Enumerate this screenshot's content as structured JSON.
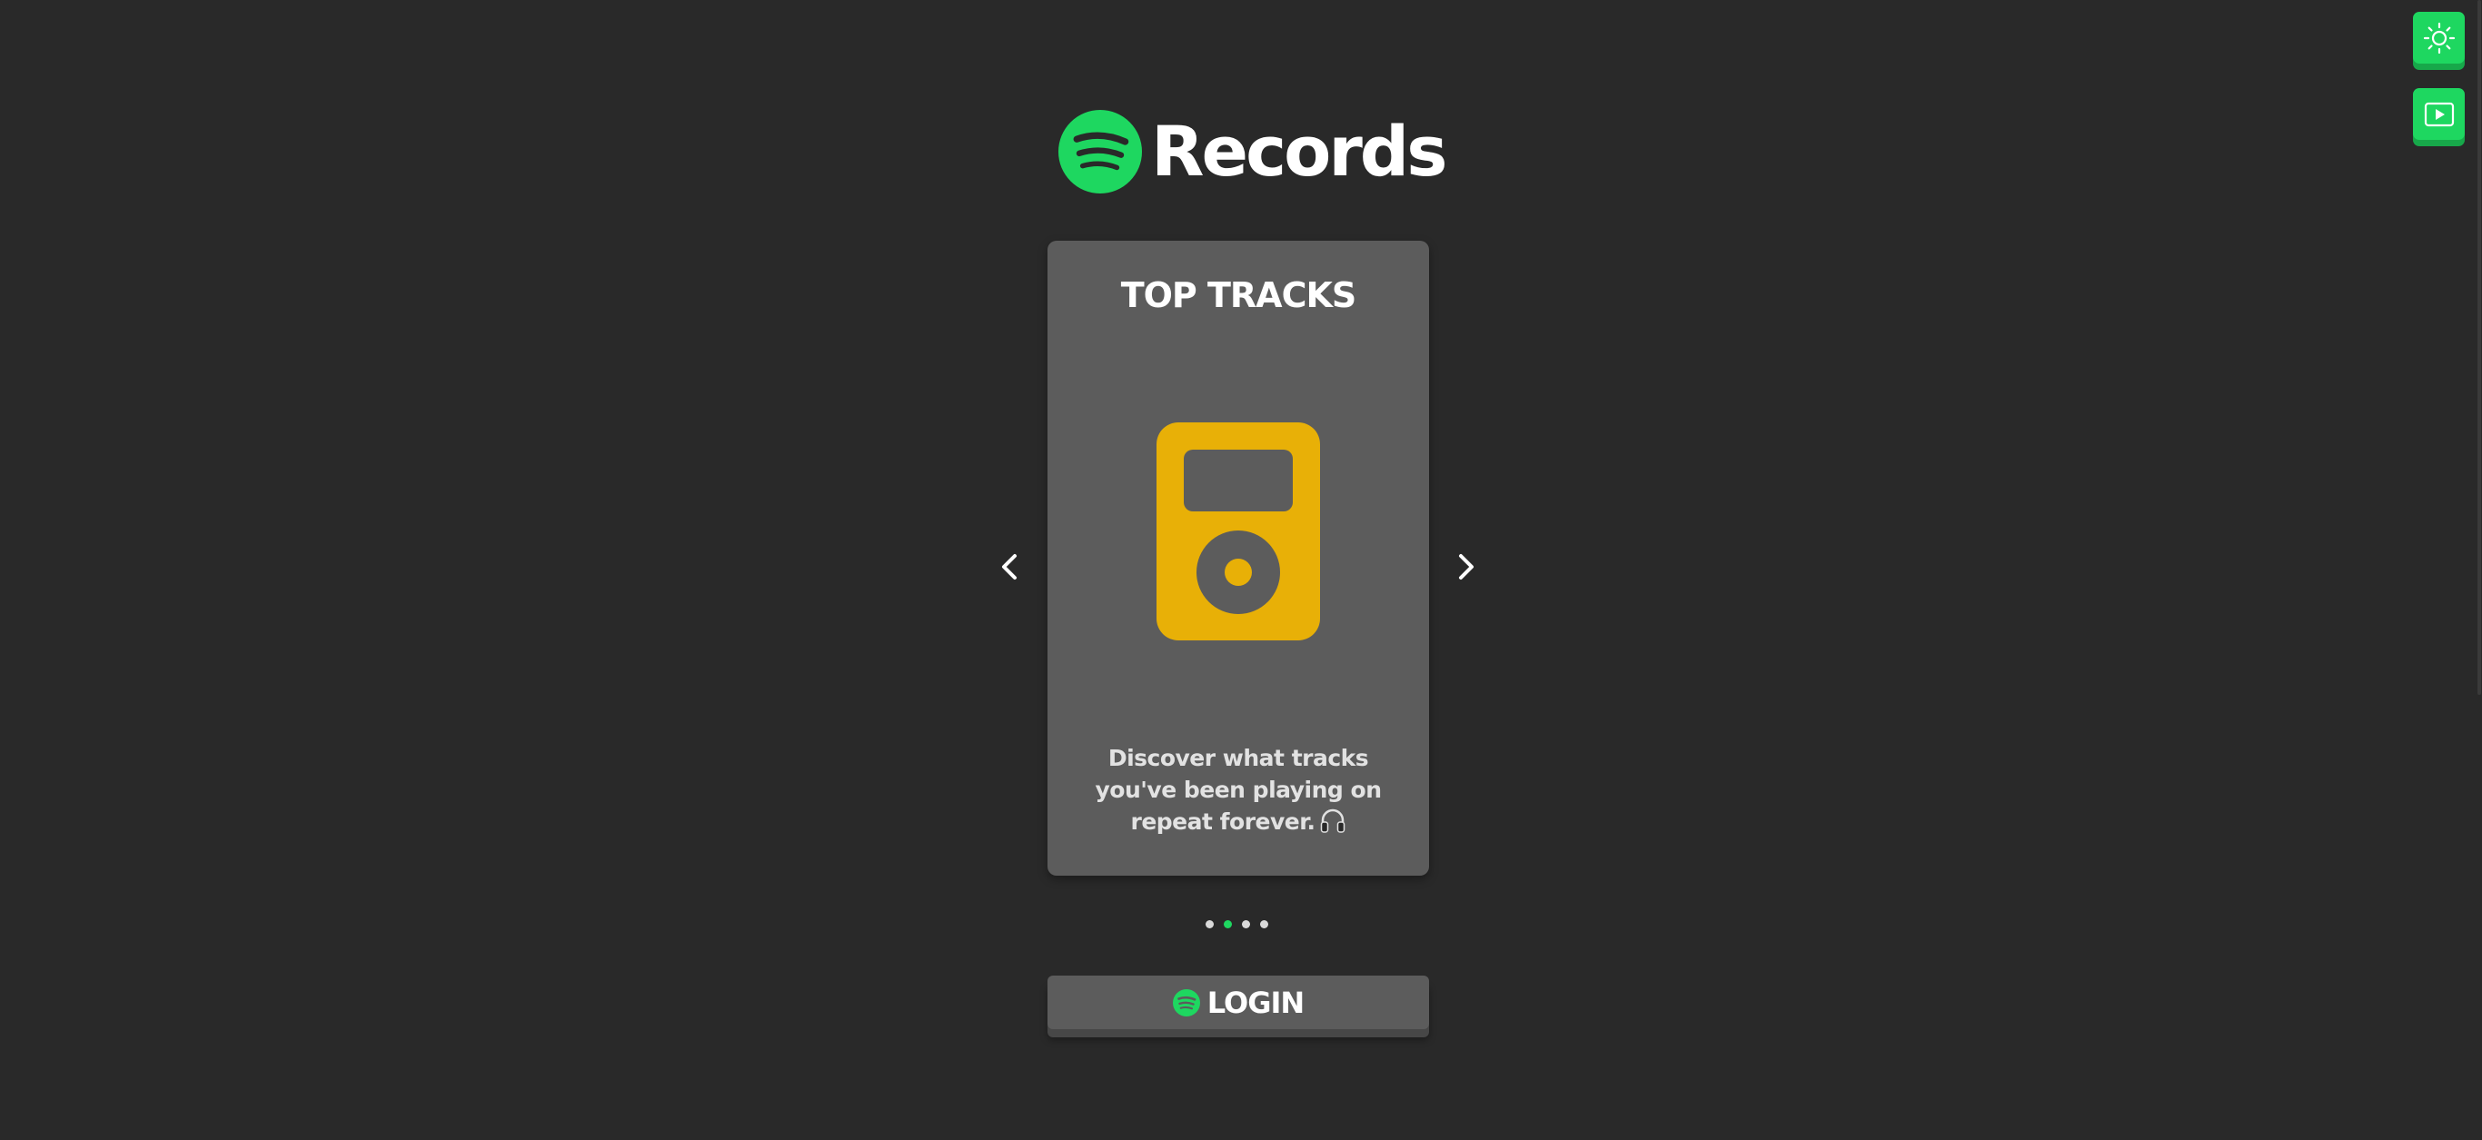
{
  "brand": {
    "name": "Records",
    "accent": "#1ed760",
    "logo_icon": "spotify-logo-icon"
  },
  "colors": {
    "background": "#292929",
    "card": "#5c5c5c",
    "ipod": "#e8b007"
  },
  "carousel": {
    "prev_icon": "chevron-left-icon",
    "next_icon": "chevron-right-icon",
    "active_index": 1,
    "dot_count": 4,
    "slide": {
      "title": "TOP TRACKS",
      "illustration": "ipod-icon",
      "description": "Discover what tracks you've been playing on repeat forever.",
      "description_icon": "headphones-icon"
    }
  },
  "login": {
    "label": "LOGIN",
    "icon": "spotify-logo-icon"
  },
  "corner_buttons": {
    "theme_icon": "sun-icon",
    "demo_icon": "play-icon"
  }
}
